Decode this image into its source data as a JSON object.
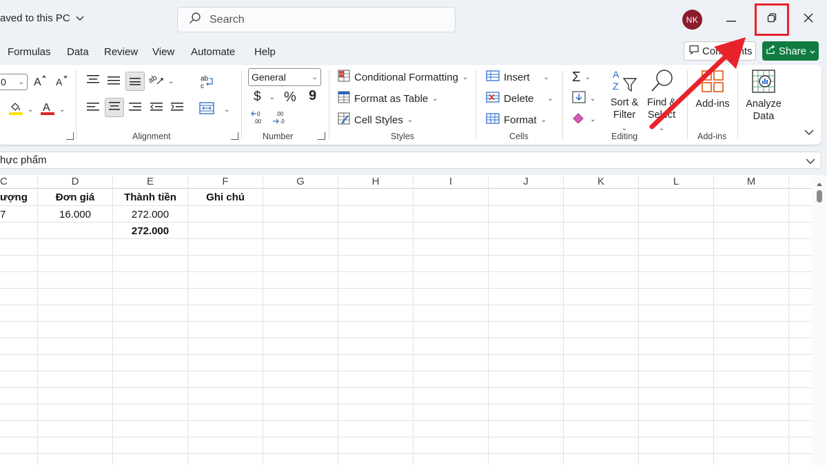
{
  "titlebar": {
    "doc_title": "aved to this PC",
    "search_placeholder": "Search",
    "avatar_initials": "NK"
  },
  "tabs": [
    {
      "label": "Formulas"
    },
    {
      "label": "Data"
    },
    {
      "label": "Review"
    },
    {
      "label": "View"
    },
    {
      "label": "Automate"
    },
    {
      "label": "Help"
    }
  ],
  "actions": {
    "comments_label": "Comments",
    "share_label": "Share"
  },
  "ribbon": {
    "font_size_value": "0",
    "alignment_label": "Alignment",
    "number_label": "Number",
    "number_format": "General",
    "currency_symbol": "$",
    "percent_symbol": "%",
    "comma_symbol": "9",
    "styles": {
      "label": "Styles",
      "conditional_formatting": "Conditional Formatting",
      "format_as_table": "Format as Table",
      "cell_styles": "Cell Styles"
    },
    "cells": {
      "label": "Cells",
      "insert": "Insert",
      "delete": "Delete",
      "format": "Format"
    },
    "editing": {
      "label": "Editing",
      "sort_filter_1": "Sort &",
      "sort_filter_2": "Filter",
      "find_select_1": "Find &",
      "find_select_2": "Select"
    },
    "addins": {
      "label": "Add-ins",
      "button_label": "Add-ins"
    },
    "analyze": {
      "label_1": "Analyze",
      "label_2": "Data"
    }
  },
  "formula_bar": {
    "value": "hực phẩm"
  },
  "sheet": {
    "columns": [
      "C",
      "D",
      "E",
      "F",
      "G",
      "H",
      "I",
      "J",
      "K",
      "L",
      "M"
    ],
    "header_row": {
      "C": "ượng",
      "D": "Đơn giá",
      "E": "Thành tiền",
      "F": "Ghi chú"
    },
    "data_row": {
      "C": "7",
      "D": "16.000",
      "E": "272.000"
    },
    "total_row": {
      "E": "272.000"
    }
  },
  "colors": {
    "accent_green": "#107c41",
    "avatar_bg": "#8b1c2c",
    "annotation_red": "#e8222b"
  }
}
